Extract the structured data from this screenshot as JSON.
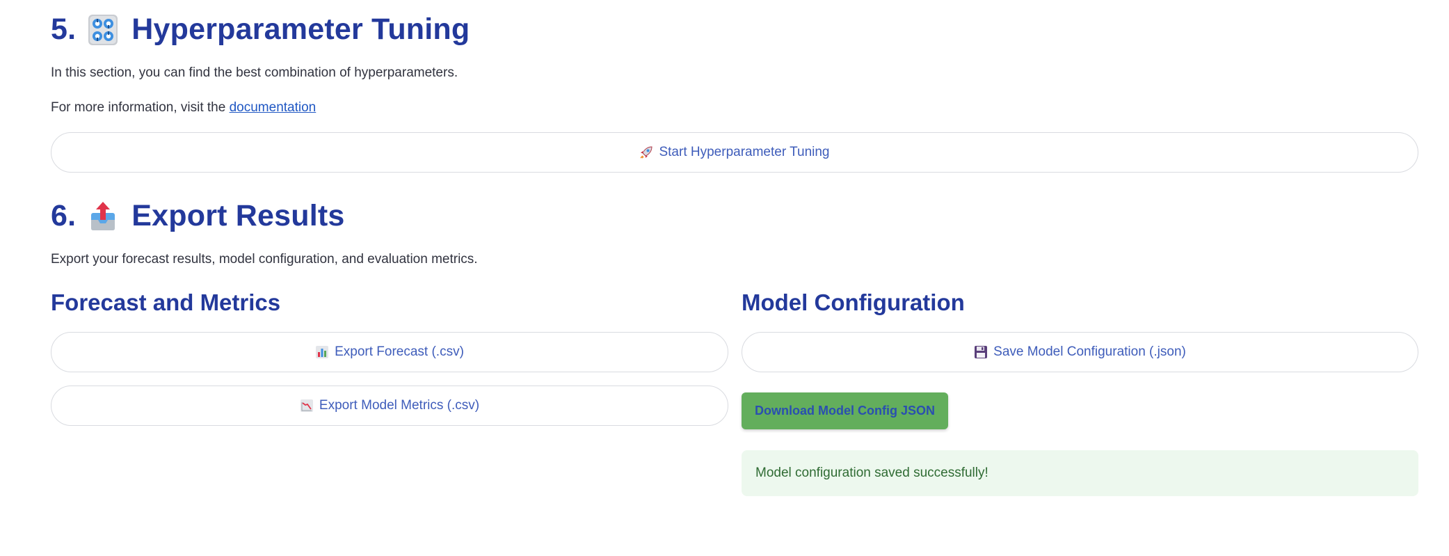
{
  "section5": {
    "number": "5.",
    "icon": "control-knobs-icon",
    "title": "Hyperparameter Tuning",
    "description": "In this section, you can find the best combination of hyperparameters.",
    "more_info_prefix": "For more information, visit the",
    "doc_link": "documentation",
    "start_button": {
      "icon": "rocket-icon",
      "label": "Start Hyperparameter Tuning"
    }
  },
  "section6": {
    "number": "6.",
    "icon": "outbox-tray-icon",
    "title": "Export Results",
    "description": "Export your forecast results, model configuration, and evaluation metrics.",
    "forecast_metrics": {
      "heading": "Forecast and Metrics",
      "export_forecast": {
        "icon": "bar-chart-icon",
        "label": "Export Forecast (.csv)"
      },
      "export_metrics": {
        "icon": "chart-decreasing-icon",
        "label": "Export Model Metrics (.csv)"
      }
    },
    "model_config": {
      "heading": "Model Configuration",
      "save_config": {
        "icon": "floppy-disk-icon",
        "label": "Save Model Configuration (.json)"
      },
      "download_button": "Download Model Config JSON",
      "success_message": "Model configuration saved successfully!"
    }
  },
  "colors": {
    "heading": "#23399b",
    "text": "#31333f",
    "link": "#1f57c3",
    "button_text": "#3e5cba",
    "button_border": "#d9dbe0",
    "download_bg": "#63ae5c",
    "success_bg": "#edf8ee",
    "success_text": "#2f6b33"
  }
}
